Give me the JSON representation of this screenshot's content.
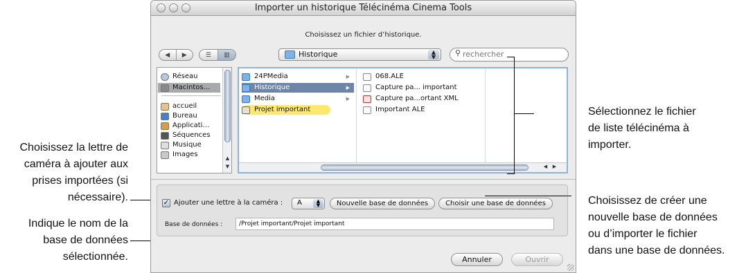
{
  "window": {
    "title": "Importer un historique Télécinéma Cinema Tools",
    "prompt": "Choisissez un fichier d’historique."
  },
  "toolbar": {
    "back_icon": "back-arrow-icon",
    "forward_icon": "forward-arrow-icon",
    "list_view_icon": "list-view-icon",
    "column_view_icon": "column-view-icon",
    "location": "Historique",
    "search_placeholder": "rechercher"
  },
  "sidebar": {
    "items": [
      {
        "label": "Réseau",
        "icon": "network-icon"
      },
      {
        "label": "Macintos…",
        "icon": "hard-disk-icon",
        "selected": true
      },
      {
        "label": "accueil",
        "icon": "home-icon"
      },
      {
        "label": "Bureau",
        "icon": "desktop-icon"
      },
      {
        "label": "Applicati…",
        "icon": "applications-icon"
      },
      {
        "label": "Séquences",
        "icon": "movies-icon"
      },
      {
        "label": "Musique",
        "icon": "music-icon"
      },
      {
        "label": "Images",
        "icon": "pictures-icon"
      }
    ]
  },
  "columns": {
    "col1": [
      {
        "label": "24PMedia",
        "type": "folder",
        "has_children": true
      },
      {
        "label": "Historique",
        "type": "folder",
        "has_children": true,
        "selected": true
      },
      {
        "label": "Media",
        "type": "folder",
        "has_children": true
      },
      {
        "label": "Projet important",
        "type": "project",
        "highlighted": true
      }
    ],
    "col2": [
      {
        "label": "068.ALE",
        "type": "doc"
      },
      {
        "label": "Capture pa... important",
        "type": "doc"
      },
      {
        "label": "Capture pa...ortant XML",
        "type": "xml"
      },
      {
        "label": "Important ALE",
        "type": "doc"
      }
    ]
  },
  "options": {
    "add_letter_label": "Ajouter une lettre à la caméra :",
    "add_letter_checked": true,
    "camera_letter": "A",
    "new_db_button": "Nouvelle base de données",
    "choose_db_button": "Choisir une base de données",
    "db_label": "Base de données :",
    "db_path": "/Projet important/Projet important"
  },
  "buttons": {
    "cancel": "Annuler",
    "open": "Ouvrir"
  },
  "callouts": {
    "left_top": [
      "Choisissez la lettre de",
      "caméra à ajouter aux",
      "prises importées (si",
      "nécessaire)."
    ],
    "left_bottom": [
      "Indique le nom de la",
      "base de données",
      "sélectionnée."
    ],
    "right_top": [
      "Sélectionnez le fichier",
      "de liste télécinéma à",
      "importer."
    ],
    "right_bottom": [
      "Choisissez de créer une",
      "nouvelle base de données",
      "ou d’importer le fichier",
      "dans une base de données."
    ]
  }
}
